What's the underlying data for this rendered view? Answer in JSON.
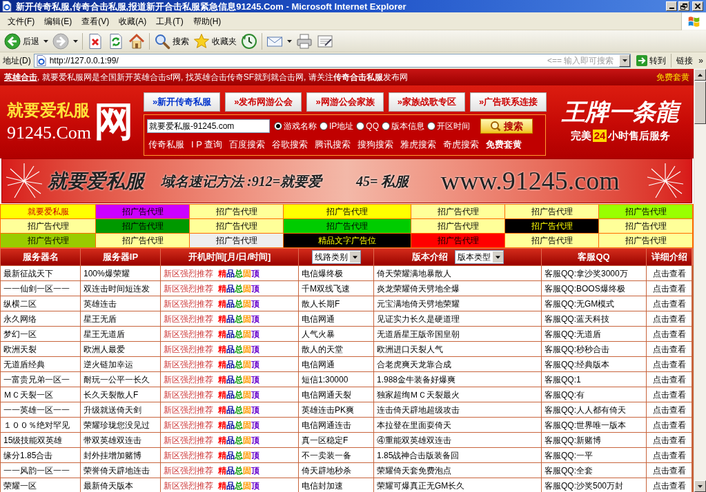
{
  "window": {
    "title": "新开传奇私服,传奇合击私服,报道新开合击私服紧急信息91245.Com - Microsoft Internet Explorer"
  },
  "menu": [
    "文件(F)",
    "编辑(E)",
    "查看(V)",
    "收藏(A)",
    "工具(T)",
    "帮助(H)"
  ],
  "toolbar": [
    {
      "kind": "back",
      "label": "后退",
      "menu": true
    },
    {
      "kind": "forward",
      "menu": true
    },
    {
      "kind": "separator"
    },
    {
      "kind": "stop",
      "menu": false
    },
    {
      "kind": "refresh",
      "menu": false
    },
    {
      "kind": "home",
      "menu": false
    },
    {
      "kind": "separator"
    },
    {
      "kind": "search",
      "label": "搜索",
      "menu": false
    },
    {
      "kind": "favorites",
      "label": "收藏夹",
      "menu": false
    },
    {
      "kind": "history",
      "menu": false
    },
    {
      "kind": "separator"
    },
    {
      "kind": "mail",
      "menu": true
    },
    {
      "kind": "print",
      "menu": false
    },
    {
      "kind": "edit",
      "menu": false
    }
  ],
  "address_bar": {
    "label": "地址(D)",
    "url": "http://127.0.0.1:99/",
    "hint": "<== 输入即可搜索",
    "go": "转到",
    "links": "链接",
    "more": "»"
  },
  "top_bar": {
    "link": "英雄合击",
    "text": ", 就要爱私服网是全国新开英雄合击sf网, 找英雄合击传奇SF就到就合击网, 请关注**传奇合击私服**发布网",
    "right_link": "免费套黄"
  },
  "logo": {
    "brand": "就要爱私服",
    "mark": "网",
    "domain": "91245.Com"
  },
  "nav": [
    {
      "label": "»新开传奇私服",
      "selected": true
    },
    {
      "label": "»发布网游公会",
      "selected": false
    },
    {
      "label": "»网游公会家族",
      "selected": false
    },
    {
      "label": "»家族战歌专区",
      "selected": false
    },
    {
      "label": "»广告联系连接",
      "selected": false
    }
  ],
  "search": {
    "value": "就要爱私服-91245.com",
    "options": [
      {
        "label": "游戏名称",
        "selected": true
      },
      {
        "label": "IP地址",
        "selected": false
      },
      {
        "label": "QQ",
        "selected": false
      },
      {
        "label": "版本信息",
        "selected": false
      },
      {
        "label": "开区时间",
        "selected": false
      }
    ],
    "button": "搜索",
    "links": [
      {
        "label": "传奇私服",
        "bold": false
      },
      {
        "label": "I P 查询",
        "bold": false
      },
      {
        "label": "百度搜索",
        "bold": false
      },
      {
        "label": "谷歌搜索",
        "bold": false
      },
      {
        "label": "腾讯搜索",
        "bold": false
      },
      {
        "label": "搜狗搜索",
        "bold": false
      },
      {
        "label": "雅虎搜索",
        "bold": false
      },
      {
        "label": "奇虎搜索",
        "bold": false
      },
      {
        "label": "免费套黄",
        "bold": true
      }
    ]
  },
  "promo": {
    "brand": "王牌一条龍",
    "prefix": "完美",
    "number": "24",
    "suffix": "小时售后服务"
  },
  "banner": {
    "brand": "就要爱私服",
    "hint": "域名速记方法 :912=就要爱",
    "hint2": "45= 私服",
    "url": "www.91245.com"
  },
  "ads": {
    "rows": [
      {
        "cells": [
          {
            "label": "就要爱私服",
            "color": "#ffff00",
            "kind": "site"
          },
          {
            "label": "招广告代理",
            "color": "#cc00ff",
            "kind": "ad"
          },
          {
            "label": "招广告代理",
            "color": "#ffff99",
            "kind": "ad"
          },
          {
            "label": "招广告代理",
            "color": "#ffff00",
            "kind": "ad"
          },
          {
            "label": "招广告代理",
            "color": "#ffff99",
            "kind": "ad"
          },
          {
            "label": "招广告代理",
            "color": "#ffff99",
            "kind": "ad"
          },
          {
            "label": "招广告代理",
            "color": "#99ff00",
            "kind": "ad"
          }
        ]
      },
      {
        "cells": [
          {
            "label": "招广告代理",
            "color": "#ffff99",
            "kind": "ad"
          },
          {
            "label": "招广告代理",
            "color": "#009900",
            "kind": "ad"
          },
          {
            "label": "招广告代理",
            "color": "#ffff99",
            "kind": "ad"
          },
          {
            "label": "招广告代理",
            "color": "#00cc00",
            "kind": "ad"
          },
          {
            "label": "招广告代理",
            "color": "#ffff99",
            "kind": "ad"
          },
          {
            "label": "招广告代理",
            "color": "#000000",
            "kind": "ad"
          },
          {
            "label": "招广告代理",
            "color": "#ffff99",
            "kind": "ad"
          }
        ]
      },
      {
        "cells": [
          {
            "label": "招广告代理",
            "color": "#99cc00",
            "kind": "ad"
          },
          {
            "label": "招广告代理",
            "color": "#ffff99",
            "kind": "ad"
          },
          {
            "label": "招广告代理",
            "color": "#eeeeee",
            "kind": "ad"
          },
          {
            "label": "精品文字广告位",
            "color": "#000000",
            "kind": "ad"
          },
          {
            "label": "招广告代理",
            "color": "#ff0000",
            "kind": "ad"
          },
          {
            "label": "招广告代理",
            "color": "#ffff99",
            "kind": "ad"
          },
          {
            "label": "招广告代理",
            "color": "#ffff99",
            "kind": "ad"
          }
        ]
      }
    ]
  },
  "table": {
    "columns": [
      {
        "kind": "label",
        "label": "服务器名"
      },
      {
        "kind": "label",
        "label": "服务器IP"
      },
      {
        "kind": "label",
        "label": "开机时间[月/日/时间]"
      },
      {
        "kind": "select",
        "value": "线路类别"
      },
      {
        "kind": "label_select",
        "label": "版本介绍",
        "value": "版本类型"
      },
      {
        "kind": "label",
        "label": "客服QQ"
      },
      {
        "kind": "label",
        "label": "详细介绍"
      }
    ],
    "rows": [
      {
        "name": "最新征战天下",
        "ip": "100%爆荣耀",
        "promo": "新区强烈推荐",
        "tags": [
          {
            "label": "精",
            "color": "#ff0000"
          },
          {
            "label": "品",
            "color": "#000099"
          },
          {
            "label": "总",
            "color": "#009900"
          },
          {
            "label": "固",
            "color": "#ff9900"
          },
          {
            "label": "顶",
            "color": "#6600cc"
          }
        ],
        "line": "电信爆终极",
        "version": "倚天荣耀满地暴散人",
        "qq": "客服QQ:拿沙奖3000万",
        "detail": "点击查看"
      },
      {
        "name": "一一仙剑一区一一",
        "ip": "双连击时间短连发",
        "promo": "新区强烈推荐",
        "tags": [
          {
            "label": "精",
            "color": "#ff0000"
          },
          {
            "label": "品",
            "color": "#000099"
          },
          {
            "label": "总",
            "color": "#009900"
          },
          {
            "label": "固",
            "color": "#ff9900"
          },
          {
            "label": "顶",
            "color": "#6600cc"
          }
        ],
        "line": "千M双线飞速",
        "version": "炎龙荣耀倚天劈地全爆",
        "qq": "客服QQ:BOOS爆终极",
        "detail": "点击查看"
      },
      {
        "name": "纵横二区",
        "ip": "英雄连击",
        "promo": "新区强烈推荐",
        "tags": [
          {
            "label": "精",
            "color": "#ff0000"
          },
          {
            "label": "品",
            "color": "#000099"
          },
          {
            "label": "总",
            "color": "#009900"
          },
          {
            "label": "固",
            "color": "#ff9900"
          },
          {
            "label": "顶",
            "color": "#6600cc"
          }
        ],
        "line": "散人长期F",
        "version": "元宝满地倚天劈地荣耀",
        "qq": "客服QQ:无GM模式",
        "detail": "点击查看"
      },
      {
        "name": "永久网络",
        "ip": "星王无盾",
        "promo": "新区强烈推荐",
        "tags": [
          {
            "label": "精",
            "color": "#ff0000"
          },
          {
            "label": "品",
            "color": "#000099"
          },
          {
            "label": "总",
            "color": "#009900"
          },
          {
            "label": "固",
            "color": "#ff9900"
          },
          {
            "label": "顶",
            "color": "#6600cc"
          }
        ],
        "line": "电信网通",
        "version": "见证实力长久是硬道理",
        "qq": "客服QQ:蓝天科技",
        "detail": "点击查看"
      },
      {
        "name": "梦幻一区",
        "ip": "星王无道盾",
        "promo": "新区强烈推荐",
        "tags": [
          {
            "label": "精",
            "color": "#ff0000"
          },
          {
            "label": "品",
            "color": "#000099"
          },
          {
            "label": "总",
            "color": "#009900"
          },
          {
            "label": "固",
            "color": "#ff9900"
          },
          {
            "label": "顶",
            "color": "#6600cc"
          }
        ],
        "line": "人气火暴",
        "version": "无道盾星王版帝国皇朝",
        "qq": "客服QQ:无道盾",
        "detail": "点击查看"
      },
      {
        "name": "欧洲天裂",
        "ip": "欧洲人最爱",
        "promo": "新区强烈推荐",
        "tags": [
          {
            "label": "精",
            "color": "#ff0000"
          },
          {
            "label": "品",
            "color": "#000099"
          },
          {
            "label": "总",
            "color": "#009900"
          },
          {
            "label": "固",
            "color": "#ff9900"
          },
          {
            "label": "顶",
            "color": "#6600cc"
          }
        ],
        "line": "散人的天堂",
        "version": "欧洲进口天裂人气",
        "qq": "客服QQ:秒秒合击",
        "detail": "点击查看"
      },
      {
        "name": "无道盾经典",
        "ip": "逆火链加幸运",
        "promo": "新区强烈推荐",
        "tags": [
          {
            "label": "精",
            "color": "#ff0000"
          },
          {
            "label": "品",
            "color": "#000099"
          },
          {
            "label": "总",
            "color": "#009900"
          },
          {
            "label": "固",
            "color": "#ff9900"
          },
          {
            "label": "顶",
            "color": "#6600cc"
          }
        ],
        "line": "电信网通",
        "version": "合老虎爽天龙靠合成",
        "qq": "客服QQ:经典版本",
        "detail": "点击查看"
      },
      {
        "name": "一富贵兄弟一区一",
        "ip": "耐玩一公平一长久",
        "promo": "新区强烈推荐",
        "tags": [
          {
            "label": "精",
            "color": "#ff0000"
          },
          {
            "label": "品",
            "color": "#000099"
          },
          {
            "label": "总",
            "color": "#009900"
          },
          {
            "label": "固",
            "color": "#ff9900"
          },
          {
            "label": "顶",
            "color": "#6600cc"
          }
        ],
        "line": "短信1:30000",
        "version": "1.988金牛装备好爆爽",
        "qq": "客服QQ:1",
        "detail": "点击查看"
      },
      {
        "name": "ＭＣ天裂一区",
        "ip": "长久天裂散人F",
        "promo": "新区强烈推荐",
        "tags": [
          {
            "label": "精",
            "color": "#ff0000"
          },
          {
            "label": "品",
            "color": "#000099"
          },
          {
            "label": "总",
            "color": "#009900"
          },
          {
            "label": "固",
            "color": "#ff9900"
          },
          {
            "label": "顶",
            "color": "#6600cc"
          }
        ],
        "line": "电信网通天裂",
        "version": "独家超绚ＭＣ天裂最火",
        "qq": "客服QQ:有",
        "detail": "点击查看"
      },
      {
        "name": "一一英雄一区一一",
        "ip": "升级就送倚天剑",
        "promo": "新区强烈推荐",
        "tags": [
          {
            "label": "精",
            "color": "#ff0000"
          },
          {
            "label": "品",
            "color": "#000099"
          },
          {
            "label": "总",
            "color": "#009900"
          },
          {
            "label": "固",
            "color": "#ff9900"
          },
          {
            "label": "顶",
            "color": "#6600cc"
          }
        ],
        "line": "英雄连击PK爽",
        "version": "连击倚天辟地超级攻击",
        "qq": "客服QQ:人人都有倚天",
        "detail": "点击查看"
      },
      {
        "name": "１００％绝对罕见",
        "ip": "荣耀珍珑您没见过",
        "promo": "新区强烈推荐",
        "tags": [
          {
            "label": "精",
            "color": "#ff0000"
          },
          {
            "label": "品",
            "color": "#000099"
          },
          {
            "label": "总",
            "color": "#009900"
          },
          {
            "label": "固",
            "color": "#ff9900"
          },
          {
            "label": "顶",
            "color": "#6600cc"
          }
        ],
        "line": "电信网通连击",
        "version": "本拉登在里面耍倚天",
        "qq": "客服QQ:世界唯一版本",
        "detail": "点击查看"
      },
      {
        "name": "15级技能双英雄",
        "ip": "带双英雄双连击",
        "promo": "新区强烈推荐",
        "tags": [
          {
            "label": "精",
            "color": "#ff0000"
          },
          {
            "label": "品",
            "color": "#000099"
          },
          {
            "label": "总",
            "color": "#009900"
          },
          {
            "label": "固",
            "color": "#ff9900"
          },
          {
            "label": "顶",
            "color": "#6600cc"
          }
        ],
        "line": "真一区稳定F",
        "version": "④重能双英雄双连击",
        "qq": "客服QQ:新赌博",
        "detail": "点击查看"
      },
      {
        "name": "缘分1.85合击",
        "ip": "封外挂增加赌博",
        "promo": "新区强烈推荐",
        "tags": [
          {
            "label": "精",
            "color": "#ff0000"
          },
          {
            "label": "品",
            "color": "#000099"
          },
          {
            "label": "总",
            "color": "#009900"
          },
          {
            "label": "固",
            "color": "#ff9900"
          },
          {
            "label": "顶",
            "color": "#6600cc"
          }
        ],
        "line": "不一卖装一备",
        "version": "1.85战神合击版装备回",
        "qq": "客服QQ:一平",
        "detail": "点击查看"
      },
      {
        "name": "一一风韵一区一一",
        "ip": "荣誉倚天辟地连击",
        "promo": "新区强烈推荐",
        "tags": [
          {
            "label": "精",
            "color": "#ff0000"
          },
          {
            "label": "品",
            "color": "#000099"
          },
          {
            "label": "总",
            "color": "#009900"
          },
          {
            "label": "固",
            "color": "#ff9900"
          },
          {
            "label": "顶",
            "color": "#6600cc"
          }
        ],
        "line": "倚天辟地秒杀",
        "version": "荣耀倚天套免费泡点",
        "qq": "客服QQ:全套",
        "detail": "点击查看"
      },
      {
        "name": "荣耀一区",
        "ip": "最新倚天版本",
        "promo": "新区强烈推荐",
        "tags": [
          {
            "label": "精",
            "color": "#ff0000"
          },
          {
            "label": "品",
            "color": "#000099"
          },
          {
            "label": "总",
            "color": "#009900"
          },
          {
            "label": "固",
            "color": "#ff9900"
          },
          {
            "label": "顶",
            "color": "#6600cc"
          }
        ],
        "line": "电信封加速",
        "version": "荣耀可爆真正无GM长久",
        "qq": "客服QQ:沙奖500万封",
        "detail": "点击查看"
      }
    ]
  }
}
